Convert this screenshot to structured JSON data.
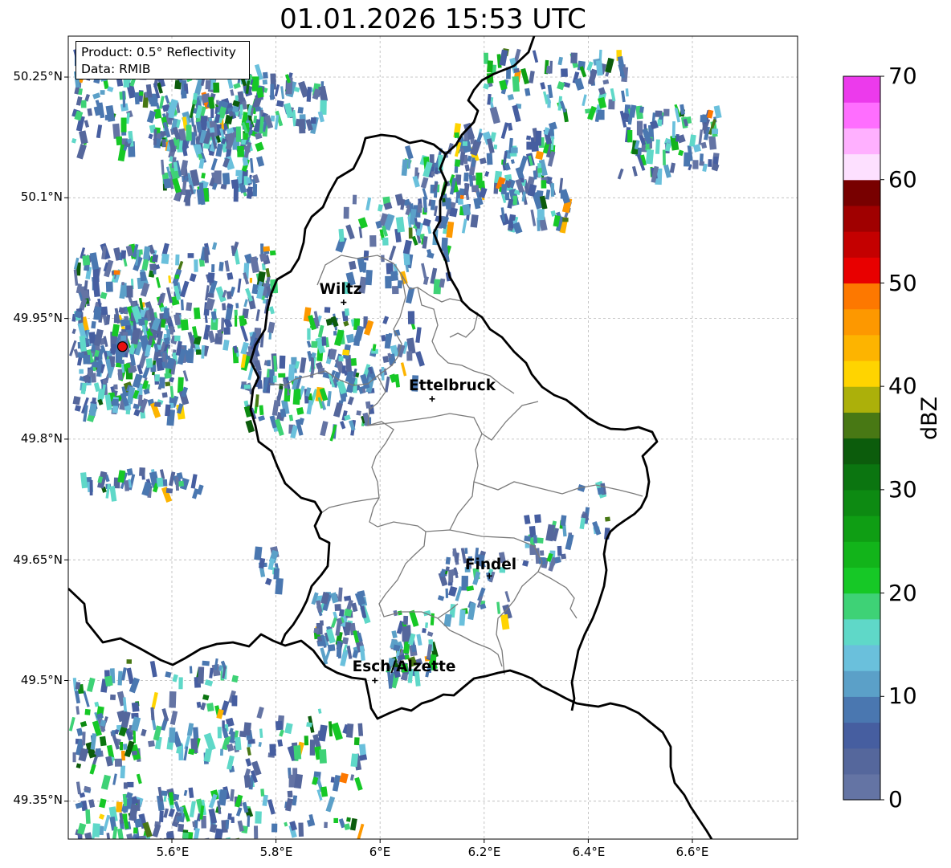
{
  "title": "01.01.2026 15:53 UTC",
  "info": {
    "product": "Product: 0.5° Reflectivity",
    "data": "Data: RMIB"
  },
  "y_ticks": [
    "50.25°N",
    "50.1°N",
    "49.95°N",
    "49.8°N",
    "49.65°N",
    "49.5°N",
    "49.35°N"
  ],
  "x_ticks": [
    "5.6°E",
    "5.8°E",
    "6°E",
    "6.2°E",
    "6.4°E",
    "6.6°E"
  ],
  "cities": [
    {
      "name": "Wiltz",
      "lon": 5.93,
      "lat": 49.97
    },
    {
      "name": "Ettelbruck",
      "lon": 6.1,
      "lat": 49.85
    },
    {
      "name": "Findel",
      "lon": 6.21,
      "lat": 49.63
    },
    {
      "name": "Esch/Alzette",
      "lon": 5.99,
      "lat": 49.5
    }
  ],
  "radar_site": {
    "lon": 5.505,
    "lat": 49.915
  },
  "colorbar": {
    "label": "dBZ",
    "ticks": [
      "0",
      "10",
      "20",
      "30",
      "40",
      "50",
      "60",
      "70"
    ],
    "min": 0,
    "max": 70,
    "step": 2.5,
    "colors": [
      "#6474a4",
      "#55679c",
      "#465ea0",
      "#4a77b0",
      "#5ba0c8",
      "#6ac0dc",
      "#5fd8c8",
      "#3ed276",
      "#16c826",
      "#12b41a",
      "#0f9e14",
      "#0d8a12",
      "#0b7510",
      "#0c5c0c",
      "#487814",
      "#acb00a",
      "#ffd400",
      "#fdb400",
      "#fd9800",
      "#fd7800",
      "#e80000",
      "#c40000",
      "#a00000",
      "#780000",
      "#fde0ff",
      "#ffb0ff",
      "#ff6eff",
      "#ec3aec"
    ]
  }
}
